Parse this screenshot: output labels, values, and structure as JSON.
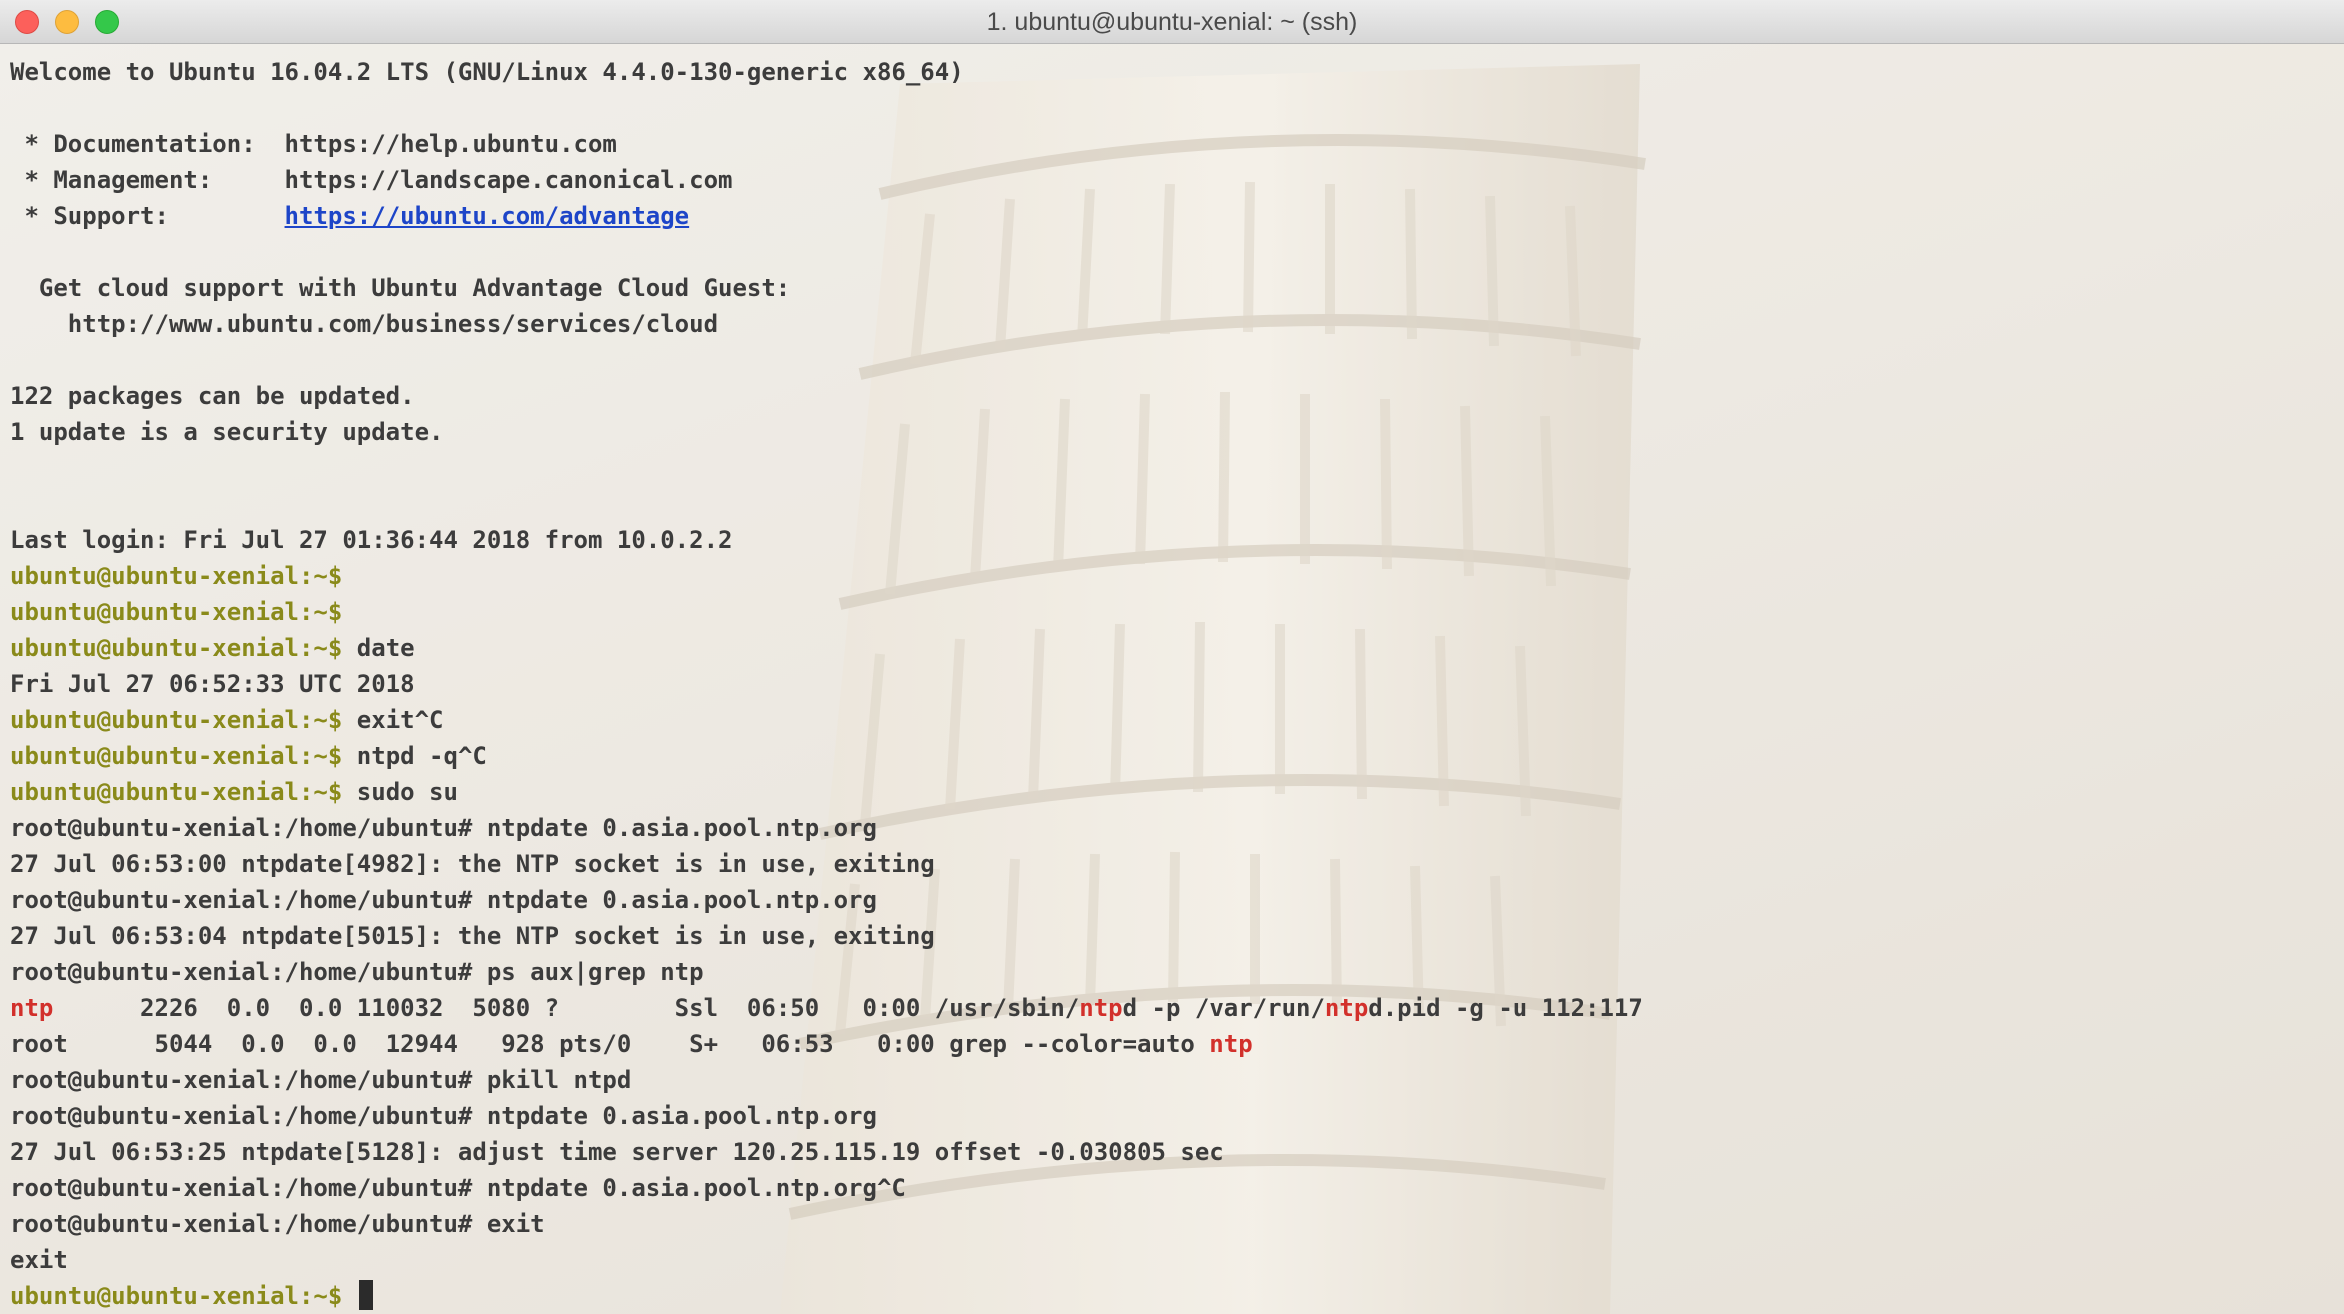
{
  "window": {
    "title": "1. ubuntu@ubuntu-xenial: ~ (ssh)"
  },
  "colors": {
    "user_prompt": "#8a8a1a",
    "highlight": "#d2302b",
    "link": "#1d45c8",
    "text": "#3c3c3c"
  },
  "terminal": {
    "motd": {
      "welcome": "Welcome to Ubuntu 16.04.2 LTS (GNU/Linux 4.4.0-130-generic x86_64)",
      "doc": " * Documentation:  https://help.ubuntu.com",
      "mgmt": " * Management:     https://landscape.canonical.com",
      "support_label": " * Support:        ",
      "support_link": "https://ubuntu.com/advantage",
      "cloud1": "  Get cloud support with Ubuntu Advantage Cloud Guest:",
      "cloud2": "    http://www.ubuntu.com/business/services/cloud",
      "packages": "122 packages can be updated.",
      "security": "1 update is a security update.",
      "last_login": "Last login: Fri Jul 27 01:36:44 2018 from 10.0.2.2"
    },
    "user_prompt": "ubuntu@ubuntu-xenial:~$",
    "root_prompt": "root@ubuntu-xenial:/home/ubuntu#",
    "cmds": {
      "date": " date",
      "exit_c": " exit^C",
      "ntpd_c": " ntpd -q^C",
      "sudo": " sudo su",
      "ntpdate": " ntpdate 0.asia.pool.ntp.org",
      "ps": " ps aux|grep ntp",
      "pkill": " pkill ntpd",
      "ntpdate_c": " ntpdate 0.asia.pool.ntp.org^C",
      "exit": " exit"
    },
    "out": {
      "date": "Fri Jul 27 06:52:33 UTC 2018",
      "err1": "27 Jul 06:53:00 ntpdate[4982]: the NTP socket is in use, exiting",
      "err2": "27 Jul 06:53:04 ntpdate[5015]: the NTP socket is in use, exiting",
      "adjust": "27 Jul 06:53:25 ntpdate[5128]: adjust time server 120.25.115.19 offset -0.030805 sec",
      "exit": "exit"
    },
    "ps": {
      "row1_user": "ntp",
      "row1_a": "      2226  0.0  0.0 110032  5080 ?        Ssl  06:50   0:00 /usr/sbin/",
      "row1_hl1": "ntp",
      "row1_b": "d -p /var/run/",
      "row1_hl2": "ntp",
      "row1_c": "d.pid -g -u 112:117",
      "row2_a": "root      5044  0.0  0.0  12944   928 pts/0    S+   06:53   0:00 grep --color=auto ",
      "row2_hl": "ntp"
    }
  }
}
